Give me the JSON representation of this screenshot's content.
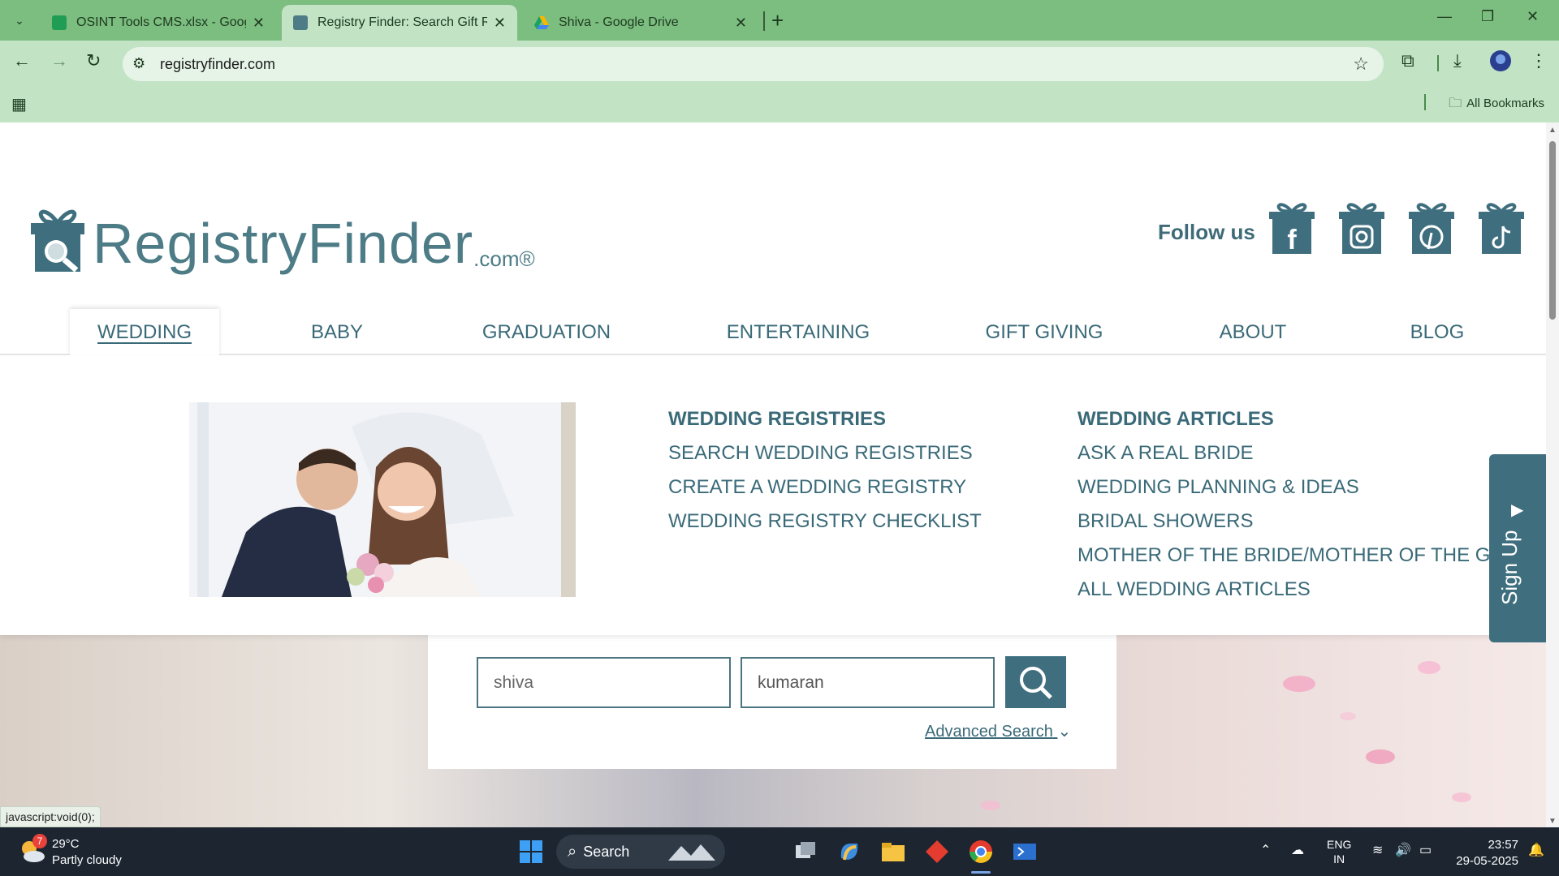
{
  "browser": {
    "tabs": [
      {
        "title": "OSINT Tools CMS.xlsx - Google",
        "active": false
      },
      {
        "title": "Registry Finder: Search Gift Reg",
        "active": true
      },
      {
        "title": "Shiva - Google Drive",
        "active": false
      }
    ],
    "url": "registryfinder.com",
    "all_bookmarks": "All Bookmarks",
    "status_text": "javascript:void(0);"
  },
  "site": {
    "logo_text": "RegistryFinder",
    "logo_suffix": ".com®",
    "follow_label": "Follow us",
    "social": [
      "facebook-icon",
      "instagram-icon",
      "pinterest-icon",
      "tiktok-icon"
    ],
    "accent": "#3f6f7e",
    "nav": [
      "WEDDING",
      "BABY",
      "GRADUATION",
      "ENTERTAINING",
      "GIFT GIVING",
      "ABOUT",
      "BLOG"
    ],
    "mega": {
      "col1": [
        "WEDDING REGISTRIES",
        "SEARCH WEDDING REGISTRIES",
        "CREATE A WEDDING REGISTRY",
        "WEDDING REGISTRY CHECKLIST"
      ],
      "col2": [
        "WEDDING ARTICLES",
        "ASK A REAL BRIDE",
        "WEDDING PLANNING & IDEAS",
        "BRIDAL SHOWERS",
        "MOTHER OF THE BRIDE/MOTHER OF THE GROOM",
        "ALL WEDDING ARTICLES"
      ]
    },
    "search": {
      "first_name": "shiva",
      "last_name": "kumaran",
      "advanced": "Advanced Search"
    },
    "signup": "Sign Up"
  },
  "taskbar": {
    "temp": "29°C",
    "weather": "Partly cloudy",
    "weather_badge": "7",
    "search": "Search",
    "lang1": "ENG",
    "lang2": "IN",
    "time": "23:57",
    "date": "29-05-2025"
  }
}
